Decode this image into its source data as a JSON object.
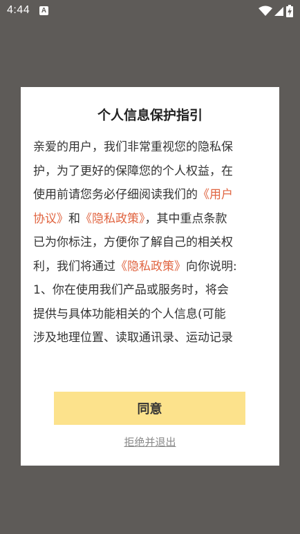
{
  "status_bar": {
    "time": "4:44",
    "notification_icon": "a-letter-icon",
    "icons": [
      "wifi-icon",
      "cellular-signal-icon",
      "battery-icon"
    ]
  },
  "dialog": {
    "title": "个人信息保护指引",
    "body": {
      "line1": "亲爱的用户，我们非常重视您的隐私保",
      "line2": "护，为了更好的保障您的个人权益，在",
      "line3_text": "使用前请您务必仔细阅读我们的",
      "link_user_agreement_part1": "《用户",
      "link_user_agreement_part2": "协议》",
      "line4_and": "和",
      "link_privacy_policy_1": "《隐私政策》",
      "line4_rest": "，其中重点条款",
      "line5": "已为你标注，方便你了解自己的相关权",
      "line6_text": "利，我们将通过",
      "link_privacy_policy_2": "《隐私政策》",
      "line6_rest": "向你说明:",
      "line7": "1、你在使用我们产品或服务时，将会",
      "line8": "提供与具体功能相关的个人信息(可能",
      "line9": "涉及地理位置、读取通讯录、运动记录"
    },
    "agree_label": "同意",
    "reject_label": "拒绝并退出"
  },
  "colors": {
    "overlay": "#5e5b58",
    "link": "#e06440",
    "agree_button": "#fce28c",
    "reject_text": "#8a8a8a"
  }
}
